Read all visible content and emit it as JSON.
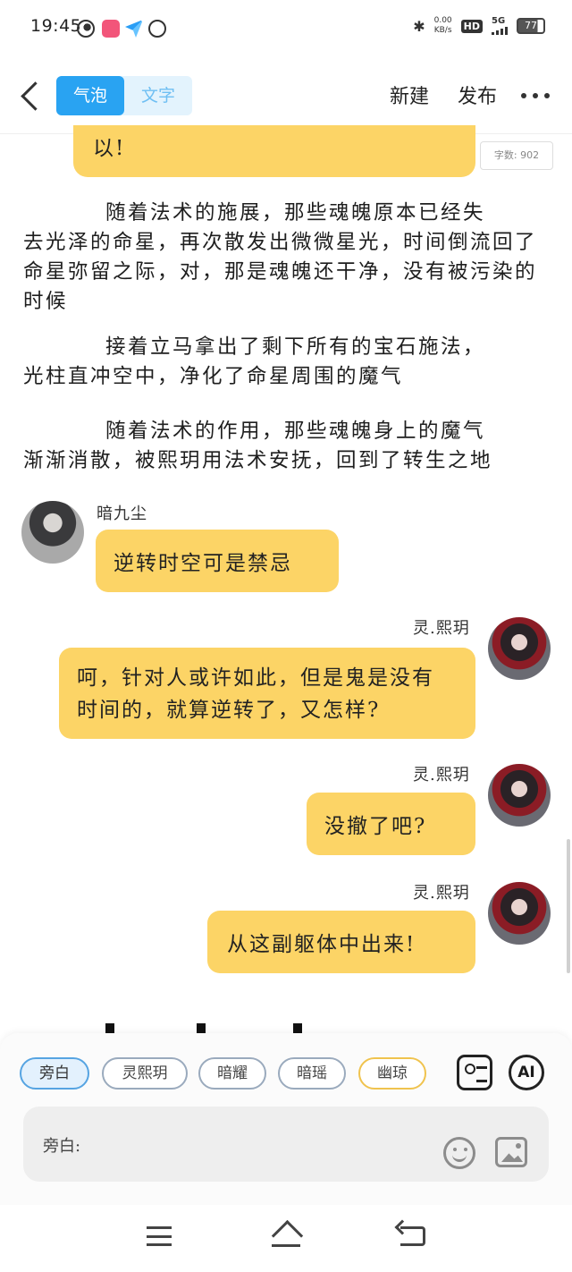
{
  "status_bar": {
    "time": "19:45",
    "net_speed": "0.00",
    "net_unit": "KB/s",
    "hd": "HD",
    "network": "5G",
    "battery": "77"
  },
  "header": {
    "tab_bubble": "气泡",
    "tab_text": "文字",
    "new_label": "新建",
    "publish_label": "发布"
  },
  "content": {
    "top_bubble_text": "以!",
    "word_count": "字数: 902",
    "paragraphs": [
      {
        "first": "随着法术的施展，那些魂魄原本已经失",
        "rest": "去光泽的命星，再次散发出微微星光，时间倒流回了命星弥留之际，对，那是魂魄还干净，没有被污染的时候"
      },
      {
        "first": "接着立马拿出了剩下所有的宝石施法，",
        "rest": "光柱直冲空中，净化了命星周围的魔气"
      },
      {
        "first": "随着法术的作用，那些魂魄身上的魔气",
        "rest": "渐渐消散，被熙玥用法术安抚，回到了转生之地"
      }
    ],
    "messages": [
      {
        "speaker": "暗九尘",
        "text": "逆转时空可是禁忌"
      },
      {
        "speaker": "灵.熙玥",
        "text": "呵，针对人或许如此，但是鬼是没有时间的，就算逆转了，又怎样?"
      },
      {
        "speaker": "灵.熙玥",
        "text": "没撤了吧?"
      },
      {
        "speaker": "灵.熙玥",
        "text": "从这副躯体中出来!"
      }
    ]
  },
  "composer": {
    "characters": [
      "旁白",
      "灵熙玥",
      "暗耀",
      "暗瑶",
      "幽琼"
    ],
    "ai_label": "AI",
    "input_prefix": "旁白:"
  },
  "colors": {
    "accent_blue": "#29a3f2",
    "bubble_yellow": "#fcd466"
  }
}
